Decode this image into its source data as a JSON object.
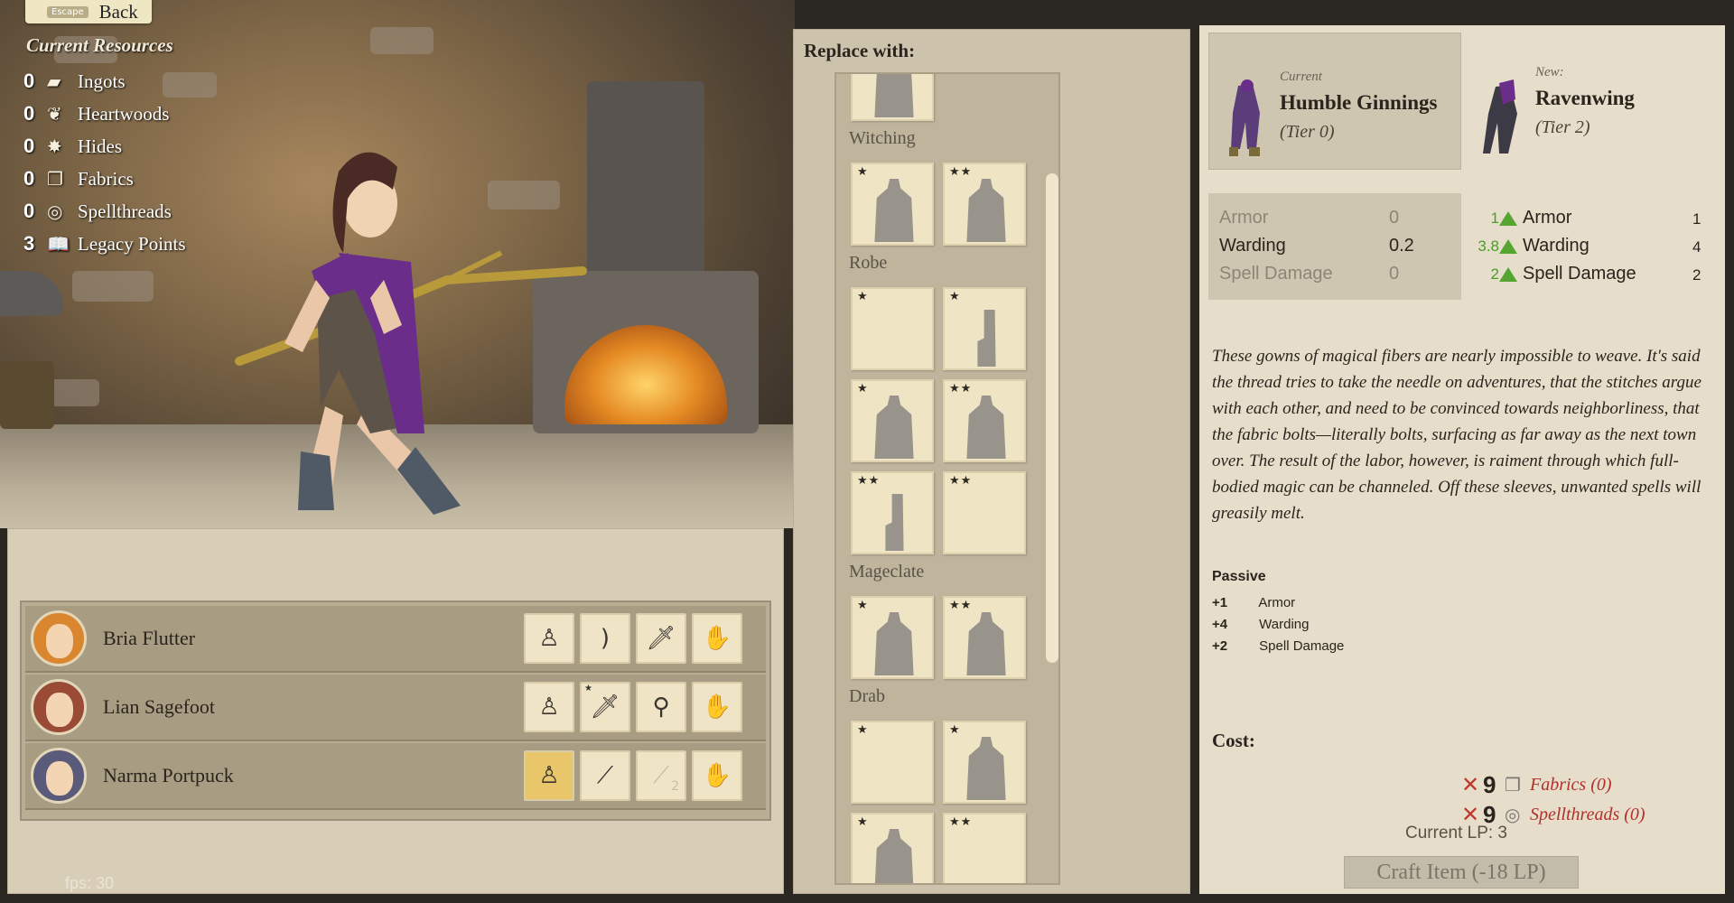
{
  "nav": {
    "escape_key": "Escape",
    "back_label": "Back"
  },
  "resources": {
    "title": "Current Resources",
    "items": [
      {
        "count": "0",
        "icon": "ingot-icon",
        "label": "Ingots"
      },
      {
        "count": "0",
        "icon": "heartwood-icon",
        "label": "Heartwoods"
      },
      {
        "count": "0",
        "icon": "hide-icon",
        "label": "Hides"
      },
      {
        "count": "0",
        "icon": "fabric-icon",
        "label": "Fabrics"
      },
      {
        "count": "0",
        "icon": "spellthread-icon",
        "label": "Spellthreads"
      },
      {
        "count": "3",
        "icon": "book-icon",
        "label": "Legacy Points"
      }
    ]
  },
  "party": {
    "members": [
      {
        "name": "Bria Flutter",
        "portrait_color": "#d9862e",
        "hair": "#b8541c",
        "slots": [
          "character",
          "bow",
          "dagger",
          "hand"
        ]
      },
      {
        "name": "Lian Sagefoot",
        "portrait_color": "#9a4b36",
        "hair": "#8f3a1e",
        "slots": [
          "character",
          "dagger",
          "club",
          "hand"
        ]
      },
      {
        "name": "Narma Portpuck",
        "portrait_color": "#5a5a7a",
        "hair": "#3b2620",
        "slots": [
          "character",
          "staff",
          "scroll",
          "hand"
        ]
      }
    ],
    "slot_badge": "2"
  },
  "fps": "fps: 30",
  "replace": {
    "title": "Replace with:",
    "groups": [
      {
        "label": "Witching"
      },
      {
        "label": "Robe"
      },
      {
        "label": "Mageclate"
      },
      {
        "label": "Drab"
      }
    ]
  },
  "compare": {
    "current_title": "Current",
    "current_name": "Humble Ginnings",
    "current_tier": "(Tier 0)",
    "new_title": "New:",
    "new_name": "Ravenwing",
    "new_tier": "(Tier 2)"
  },
  "stats": {
    "current": [
      {
        "name": "Armor",
        "value": "0"
      },
      {
        "name": "Warding",
        "value": "0.2"
      },
      {
        "name": "Spell Damage",
        "value": "0"
      }
    ],
    "new": [
      {
        "delta": "1",
        "name": "Armor",
        "value": "1"
      },
      {
        "delta": "3.8",
        "name": "Warding",
        "value": "4"
      },
      {
        "delta": "2",
        "name": "Spell Damage",
        "value": "2"
      }
    ]
  },
  "description": "These gowns of magical fibers are nearly impossible to weave. It's said the thread tries to take the needle on adventures, that the stitches argue with each other, and need to be convinced towards neighborliness, that the fabric bolts—literally bolts, surfacing as far away as the next town over. The result of the labor, however, is raiment through which full-bodied magic can be channeled. Off these sleeves, unwanted spells will greasily melt.",
  "passive": {
    "title": "Passive",
    "items": [
      {
        "amount": "+1",
        "label": "Armor"
      },
      {
        "amount": "+4",
        "label": "Warding"
      },
      {
        "amount": "+2",
        "label": "Spell Damage"
      }
    ]
  },
  "cost": {
    "title": "Cost:",
    "items": [
      {
        "qty": "9",
        "label": "Fabrics (0)",
        "icon": "fabric-icon"
      },
      {
        "qty": "9",
        "label": "Spellthreads (0)",
        "icon": "spellthread-icon"
      }
    ],
    "current_lp": "Current LP: 3",
    "craft_label": "Craft Item (-18 LP)"
  },
  "colors": {
    "accent_green": "#55a630",
    "missing_red": "#b2302a",
    "selected_slot": "#e9c66a",
    "panel": "#e5dccb"
  }
}
